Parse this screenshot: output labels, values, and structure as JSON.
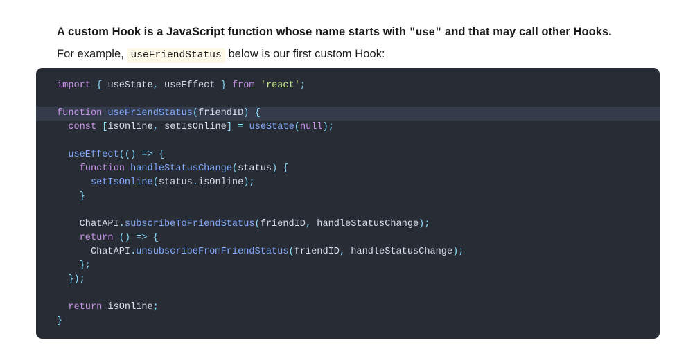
{
  "intro": {
    "bold_part_1": "A custom Hook is a JavaScript function whose name starts with ",
    "bold_mono": "\"use\"",
    "bold_part_2": " and that may call other Hooks.",
    "normal_part_1": " For example, ",
    "inline_code": "useFriendStatus",
    "normal_part_2": " below is our first custom Hook:"
  },
  "colors": {
    "code_background": "#282c34",
    "highlight_line_background": "#343b4a",
    "keyword": "#c792ea",
    "function": "#82aaff",
    "string": "#c3e88d",
    "punctuation": "#89ddff",
    "plain": "#d6deeb",
    "inline_code_background": "#fdf8e8",
    "page_background": "#ffffff",
    "text": "#1a1a1a"
  },
  "code_block": {
    "language": "jsx",
    "highlighted_line_number": 3,
    "plain_text": "import { useState, useEffect } from 'react';\n\nfunction useFriendStatus(friendID) {\n  const [isOnline, setIsOnline] = useState(null);\n\n  useEffect(() => {\n    function handleStatusChange(status) {\n      setIsOnline(status.isOnline);\n    }\n\n    ChatAPI.subscribeToFriendStatus(friendID, handleStatusChange);\n    return () => {\n      ChatAPI.unsubscribeFromFriendStatus(friendID, handleStatusChange);\n    };\n  });\n\n  return isOnline;\n}",
    "lines": [
      {
        "highlight": false,
        "tokens": [
          {
            "t": "import",
            "c": "kw"
          },
          {
            "t": " ",
            "c": "txt"
          },
          {
            "t": "{",
            "c": "punc"
          },
          {
            "t": " useState",
            "c": "txt"
          },
          {
            "t": ",",
            "c": "punc"
          },
          {
            "t": " useEffect ",
            "c": "txt"
          },
          {
            "t": "}",
            "c": "punc"
          },
          {
            "t": " ",
            "c": "txt"
          },
          {
            "t": "from",
            "c": "kw"
          },
          {
            "t": " ",
            "c": "txt"
          },
          {
            "t": "'react'",
            "c": "str"
          },
          {
            "t": ";",
            "c": "punc"
          }
        ]
      },
      {
        "highlight": false,
        "tokens": []
      },
      {
        "highlight": true,
        "tokens": [
          {
            "t": "function",
            "c": "kw"
          },
          {
            "t": " ",
            "c": "txt"
          },
          {
            "t": "useFriendStatus",
            "c": "fn"
          },
          {
            "t": "(",
            "c": "punc"
          },
          {
            "t": "friendID",
            "c": "txt"
          },
          {
            "t": ")",
            "c": "punc"
          },
          {
            "t": " ",
            "c": "txt"
          },
          {
            "t": "{",
            "c": "punc"
          }
        ]
      },
      {
        "highlight": false,
        "tokens": [
          {
            "t": "  ",
            "c": "txt"
          },
          {
            "t": "const",
            "c": "kw"
          },
          {
            "t": " ",
            "c": "txt"
          },
          {
            "t": "[",
            "c": "punc"
          },
          {
            "t": "isOnline",
            "c": "txt"
          },
          {
            "t": ",",
            "c": "punc"
          },
          {
            "t": " setIsOnline",
            "c": "txt"
          },
          {
            "t": "]",
            "c": "punc"
          },
          {
            "t": " ",
            "c": "txt"
          },
          {
            "t": "=",
            "c": "punc"
          },
          {
            "t": " ",
            "c": "txt"
          },
          {
            "t": "useState",
            "c": "fn"
          },
          {
            "t": "(",
            "c": "punc"
          },
          {
            "t": "null",
            "c": "kw"
          },
          {
            "t": ")",
            "c": "punc"
          },
          {
            "t": ";",
            "c": "punc"
          }
        ]
      },
      {
        "highlight": false,
        "tokens": []
      },
      {
        "highlight": false,
        "tokens": [
          {
            "t": "  ",
            "c": "txt"
          },
          {
            "t": "useEffect",
            "c": "fn"
          },
          {
            "t": "(()",
            "c": "punc"
          },
          {
            "t": " ",
            "c": "txt"
          },
          {
            "t": "=>",
            "c": "punc"
          },
          {
            "t": " ",
            "c": "txt"
          },
          {
            "t": "{",
            "c": "punc"
          }
        ]
      },
      {
        "highlight": false,
        "tokens": [
          {
            "t": "    ",
            "c": "txt"
          },
          {
            "t": "function",
            "c": "kw"
          },
          {
            "t": " ",
            "c": "txt"
          },
          {
            "t": "handleStatusChange",
            "c": "fn"
          },
          {
            "t": "(",
            "c": "punc"
          },
          {
            "t": "status",
            "c": "txt"
          },
          {
            "t": ")",
            "c": "punc"
          },
          {
            "t": " ",
            "c": "txt"
          },
          {
            "t": "{",
            "c": "punc"
          }
        ]
      },
      {
        "highlight": false,
        "tokens": [
          {
            "t": "      ",
            "c": "txt"
          },
          {
            "t": "setIsOnline",
            "c": "fn"
          },
          {
            "t": "(",
            "c": "punc"
          },
          {
            "t": "status",
            "c": "txt"
          },
          {
            "t": ".",
            "c": "punc"
          },
          {
            "t": "isOnline",
            "c": "txt"
          },
          {
            "t": ")",
            "c": "punc"
          },
          {
            "t": ";",
            "c": "punc"
          }
        ]
      },
      {
        "highlight": false,
        "tokens": [
          {
            "t": "    ",
            "c": "txt"
          },
          {
            "t": "}",
            "c": "punc"
          }
        ]
      },
      {
        "highlight": false,
        "tokens": []
      },
      {
        "highlight": false,
        "tokens": [
          {
            "t": "    ChatAPI",
            "c": "txt"
          },
          {
            "t": ".",
            "c": "punc"
          },
          {
            "t": "subscribeToFriendStatus",
            "c": "fn"
          },
          {
            "t": "(",
            "c": "punc"
          },
          {
            "t": "friendID",
            "c": "txt"
          },
          {
            "t": ",",
            "c": "punc"
          },
          {
            "t": " handleStatusChange",
            "c": "txt"
          },
          {
            "t": ")",
            "c": "punc"
          },
          {
            "t": ";",
            "c": "punc"
          }
        ]
      },
      {
        "highlight": false,
        "tokens": [
          {
            "t": "    ",
            "c": "txt"
          },
          {
            "t": "return",
            "c": "kw"
          },
          {
            "t": " ",
            "c": "txt"
          },
          {
            "t": "()",
            "c": "punc"
          },
          {
            "t": " ",
            "c": "txt"
          },
          {
            "t": "=>",
            "c": "punc"
          },
          {
            "t": " ",
            "c": "txt"
          },
          {
            "t": "{",
            "c": "punc"
          }
        ]
      },
      {
        "highlight": false,
        "tokens": [
          {
            "t": "      ChatAPI",
            "c": "txt"
          },
          {
            "t": ".",
            "c": "punc"
          },
          {
            "t": "unsubscribeFromFriendStatus",
            "c": "fn"
          },
          {
            "t": "(",
            "c": "punc"
          },
          {
            "t": "friendID",
            "c": "txt"
          },
          {
            "t": ",",
            "c": "punc"
          },
          {
            "t": " handleStatusChange",
            "c": "txt"
          },
          {
            "t": ")",
            "c": "punc"
          },
          {
            "t": ";",
            "c": "punc"
          }
        ]
      },
      {
        "highlight": false,
        "tokens": [
          {
            "t": "    ",
            "c": "txt"
          },
          {
            "t": "};",
            "c": "punc"
          }
        ]
      },
      {
        "highlight": false,
        "tokens": [
          {
            "t": "  ",
            "c": "txt"
          },
          {
            "t": "});",
            "c": "punc"
          }
        ]
      },
      {
        "highlight": false,
        "tokens": []
      },
      {
        "highlight": false,
        "tokens": [
          {
            "t": "  ",
            "c": "txt"
          },
          {
            "t": "return",
            "c": "kw"
          },
          {
            "t": " ",
            "c": "txt"
          },
          {
            "t": "isOnline",
            "c": "txt"
          },
          {
            "t": ";",
            "c": "punc"
          }
        ]
      },
      {
        "highlight": false,
        "tokens": [
          {
            "t": "}",
            "c": "punc"
          }
        ]
      }
    ]
  }
}
